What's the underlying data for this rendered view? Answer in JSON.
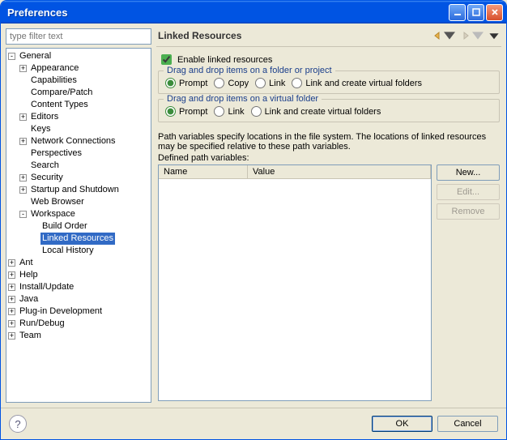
{
  "window": {
    "title": "Preferences"
  },
  "filter": {
    "placeholder": "type filter text"
  },
  "tree": {
    "items": [
      {
        "label": "General",
        "exp": "-",
        "children": [
          {
            "label": "Appearance",
            "exp": "+"
          },
          {
            "label": "Capabilities",
            "exp": " "
          },
          {
            "label": "Compare/Patch",
            "exp": " "
          },
          {
            "label": "Content Types",
            "exp": " "
          },
          {
            "label": "Editors",
            "exp": "+"
          },
          {
            "label": "Keys",
            "exp": " "
          },
          {
            "label": "Network Connections",
            "exp": "+"
          },
          {
            "label": "Perspectives",
            "exp": " "
          },
          {
            "label": "Search",
            "exp": " "
          },
          {
            "label": "Security",
            "exp": "+"
          },
          {
            "label": "Startup and Shutdown",
            "exp": "+"
          },
          {
            "label": "Web Browser",
            "exp": " "
          },
          {
            "label": "Workspace",
            "exp": "-",
            "children": [
              {
                "label": "Build Order",
                "exp": " "
              },
              {
                "label": "Linked Resources",
                "exp": " ",
                "selected": true
              },
              {
                "label": "Local History",
                "exp": " "
              }
            ]
          }
        ]
      },
      {
        "label": "Ant",
        "exp": "+"
      },
      {
        "label": "Help",
        "exp": "+"
      },
      {
        "label": "Install/Update",
        "exp": "+"
      },
      {
        "label": "Java",
        "exp": "+"
      },
      {
        "label": "Plug-in Development",
        "exp": "+"
      },
      {
        "label": "Run/Debug",
        "exp": "+"
      },
      {
        "label": "Team",
        "exp": "+"
      }
    ]
  },
  "page": {
    "title": "Linked Resources",
    "enable_label": "Enable linked resources",
    "enable_checked": true,
    "group1": {
      "title": "Drag and drop items on a folder or project",
      "options": [
        "Prompt",
        "Copy",
        "Link",
        "Link and create virtual folders"
      ],
      "selected": 0
    },
    "group2": {
      "title": "Drag and drop items on a virtual folder",
      "options": [
        "Prompt",
        "Link",
        "Link and create virtual folders"
      ],
      "selected": 0
    },
    "desc": "Path variables specify locations in the file system. The locations of linked resources may be specified relative to these path variables.",
    "defined_label": "Defined path variables:",
    "table": {
      "columns": [
        "Name",
        "Value"
      ],
      "rows": []
    },
    "buttons": {
      "new": "New...",
      "edit": "Edit...",
      "remove": "Remove"
    }
  },
  "footer": {
    "ok": "OK",
    "cancel": "Cancel"
  }
}
